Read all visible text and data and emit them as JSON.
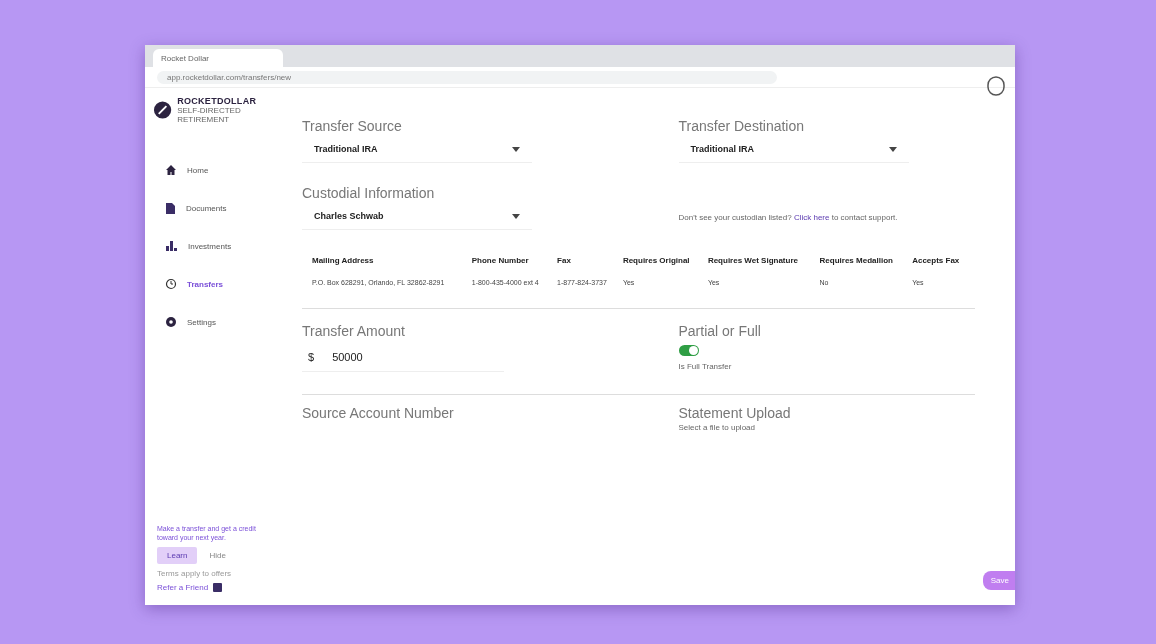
{
  "browser": {
    "tab_title": "Rocket Dollar",
    "address": "app.rocketdollar.com/transfers/new"
  },
  "brand": {
    "name": "ROCKETDOLLAR",
    "tagline": "SELF-DIRECTED RETIREMENT"
  },
  "sidebar": {
    "items": [
      {
        "label": "Home",
        "selected": false
      },
      {
        "label": "Documents",
        "selected": false
      },
      {
        "label": "Investments",
        "selected": false
      },
      {
        "label": "Transfers",
        "selected": true
      },
      {
        "label": "Settings",
        "selected": false
      }
    ],
    "promo": {
      "text": "Make a transfer and get a credit toward your next year.",
      "primary": "Learn",
      "secondary": "Hide",
      "note": "Terms apply to offers"
    },
    "refer": "Refer a Friend"
  },
  "form": {
    "transfer_source": {
      "label": "Transfer Source",
      "value": "Traditional IRA"
    },
    "transfer_destination": {
      "label": "Transfer Destination",
      "value": "Traditional IRA"
    },
    "custodian": {
      "label": "Custodial Information",
      "value": "Charles Schwab",
      "hint_before": "Don't see your custodian listed?",
      "hint_link": "Click here",
      "hint_after": "to contact support."
    },
    "table": {
      "columns": [
        "Mailing Address",
        "Phone Number",
        "Fax",
        "Requires Original",
        "Requires Wet Signature",
        "Requires Medallion",
        "Accepts Fax"
      ],
      "rows": [
        [
          "P.O. Box 628291, Orlando, FL 32862-8291",
          "1-800-435-4000 ext 4",
          "1-877-824-3737",
          "Yes",
          "Yes",
          "No",
          "Yes"
        ]
      ]
    },
    "transfer_amount": {
      "label": "Transfer Amount",
      "prefix": "$",
      "value": "50000"
    },
    "partial_full": {
      "label": "Partial or Full",
      "on": true,
      "caption": "Is Full Transfer"
    },
    "source_account": {
      "label": "Source Account Number"
    },
    "statement": {
      "label": "Statement Upload",
      "caption": "Select a file to upload"
    }
  },
  "save_button": "Save"
}
